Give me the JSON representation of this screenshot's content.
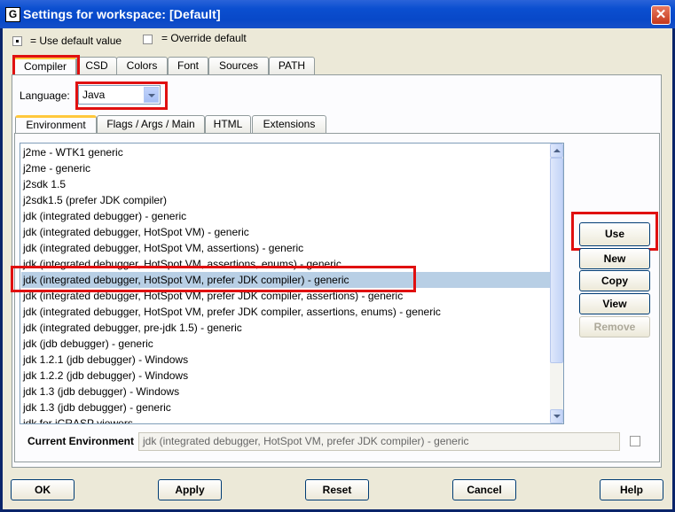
{
  "window": {
    "title": "Settings for workspace: [Default]",
    "app_icon": "G",
    "close_glyph": "✕"
  },
  "legend": {
    "default_label": "= Use default value",
    "override_label": "= Override default"
  },
  "main_tabs": [
    "Compiler",
    "CSD",
    "Colors",
    "Font",
    "Sources",
    "PATH"
  ],
  "language": {
    "label": "Language:",
    "value": "Java"
  },
  "sub_tabs": [
    "Environment",
    "Flags / Args / Main",
    "HTML",
    "Extensions"
  ],
  "environments": [
    "j2me - WTK1 generic",
    "j2me - generic",
    "j2sdk 1.5",
    "j2sdk1.5 (prefer JDK compiler)",
    "jdk (integrated debugger) - generic",
    "jdk (integrated debugger, HotSpot VM) - generic",
    "jdk (integrated debugger, HotSpot VM, assertions) - generic",
    "jdk (integrated debugger, HotSpot VM, assertions, enums) - generic",
    "jdk (integrated debugger, HotSpot VM, prefer JDK compiler) - generic",
    "jdk (integrated debugger, HotSpot VM, prefer JDK compiler, assertions) - generic",
    "jdk (integrated debugger, HotSpot VM, prefer JDK compiler, assertions, enums) - generic",
    "jdk (integrated debugger, pre-jdk 1.5) - generic",
    "jdk (jdb debugger) - generic",
    "jdk 1.2.1 (jdb debugger) - Windows",
    "jdk 1.2.2 (jdb debugger) - Windows",
    "jdk 1.3 (jdb debugger) - Windows",
    "jdk 1.3 (jdb debugger) - generic",
    "jdk for iCRASP viewers"
  ],
  "selected_index": 8,
  "side_buttons": {
    "use": "Use",
    "new": "New",
    "copy": "Copy",
    "view": "View",
    "remove": "Remove"
  },
  "current_env": {
    "label": "Current Environment",
    "value": "jdk (integrated debugger, HotSpot VM, prefer JDK compiler) - generic"
  },
  "footer_buttons": {
    "ok": "OK",
    "apply": "Apply",
    "reset": "Reset",
    "cancel": "Cancel",
    "help": "Help"
  },
  "colors": {
    "highlight_box": "#e01010",
    "selection": "#b8cfe5",
    "title_bar": "#0848c8"
  }
}
